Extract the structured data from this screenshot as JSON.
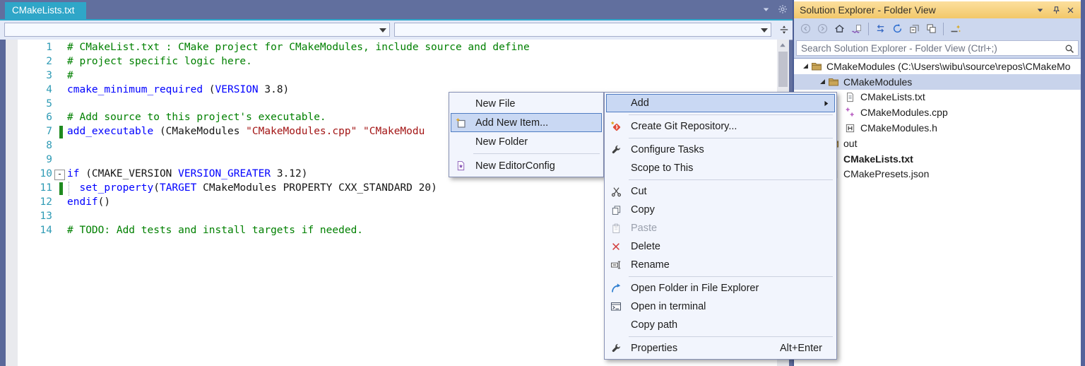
{
  "colors": {
    "tab_active": "#2fa6c8",
    "env_background": "#616f9e",
    "menu_highlight": "#c9d8f3",
    "menu_highlight_border": "#4f7cc2",
    "panel_title_orange": "#f5cc84",
    "tree_selection": "#c8d3eb",
    "comment": "#008000",
    "keyword": "#0000ff",
    "string": "#a31515",
    "line_number": "#2f9bb5",
    "change_bar_green": "#1f8a1f"
  },
  "editor": {
    "tab_label": "CMakeLists.txt",
    "lines": [
      {
        "n": 1,
        "tokens": [
          [
            "c",
            "# CMakeList.txt : CMake project for CMakeModules, include source and define"
          ]
        ]
      },
      {
        "n": 2,
        "tokens": [
          [
            "c",
            "# project specific logic here."
          ]
        ]
      },
      {
        "n": 3,
        "tokens": [
          [
            "c",
            "#"
          ]
        ]
      },
      {
        "n": 4,
        "tokens": [
          [
            "k",
            "cmake_minimum_required"
          ],
          [
            "p",
            " ("
          ],
          [
            "k",
            "VERSION"
          ],
          [
            "p",
            " 3.8)"
          ]
        ]
      },
      {
        "n": 5,
        "tokens": []
      },
      {
        "n": 6,
        "tokens": [
          [
            "c",
            "# Add source to this project's executable."
          ]
        ]
      },
      {
        "n": 7,
        "changed": true,
        "tokens": [
          [
            "k",
            "add_executable"
          ],
          [
            "p",
            " (CMakeModules "
          ],
          [
            "s",
            "\"CMakeModules.cpp\""
          ],
          [
            "p",
            " "
          ],
          [
            "s",
            "\"CMakeModu"
          ]
        ]
      },
      {
        "n": 8,
        "tokens": []
      },
      {
        "n": 9,
        "tokens": []
      },
      {
        "n": 10,
        "fold": true,
        "tokens": [
          [
            "k",
            "if"
          ],
          [
            "p",
            " (CMAKE_VERSION "
          ],
          [
            "k",
            "VERSION_GREATER"
          ],
          [
            "p",
            " 3.12)"
          ]
        ]
      },
      {
        "n": 11,
        "changed": true,
        "guide": true,
        "tokens": [
          [
            "p",
            "  "
          ],
          [
            "k",
            "set_property"
          ],
          [
            "p",
            "("
          ],
          [
            "k",
            "TARGET"
          ],
          [
            "p",
            " CMakeModules PROPERTY CXX_STANDARD 20)"
          ]
        ]
      },
      {
        "n": 12,
        "tokens": [
          [
            "k",
            "endif"
          ],
          [
            "p",
            "()"
          ]
        ]
      },
      {
        "n": 13,
        "tokens": []
      },
      {
        "n": 14,
        "tokens": [
          [
            "c",
            "# TODO: Add tests and install targets if needed."
          ]
        ]
      }
    ]
  },
  "add_submenu": {
    "items": [
      {
        "label": "New File"
      },
      {
        "label": "Add New Item...",
        "icon": "add-new-item",
        "highlighted": true
      },
      {
        "label": "New Folder"
      },
      {
        "sep": true
      },
      {
        "label": "New EditorConfig",
        "icon": "editorconfig"
      }
    ]
  },
  "context_menu": {
    "items": [
      {
        "label": "Add",
        "arrow": true,
        "highlighted": true
      },
      {
        "sep": true
      },
      {
        "label": "Create Git Repository...",
        "icon": "git"
      },
      {
        "sep": true
      },
      {
        "label": "Configure Tasks",
        "icon": "wrench"
      },
      {
        "label": "Scope to This"
      },
      {
        "sep": true
      },
      {
        "label": "Cut",
        "icon": "cut"
      },
      {
        "label": "Copy",
        "icon": "copy"
      },
      {
        "label": "Paste",
        "icon": "paste",
        "disabled": true
      },
      {
        "label": "Delete",
        "icon": "delete"
      },
      {
        "label": "Rename",
        "icon": "rename"
      },
      {
        "sep": true
      },
      {
        "label": "Open Folder in File Explorer",
        "icon": "open-folder"
      },
      {
        "label": "Open in terminal",
        "icon": "terminal"
      },
      {
        "label": "Copy path"
      },
      {
        "sep": true
      },
      {
        "label": "Properties",
        "icon": "wrench",
        "shortcut": "Alt+Enter"
      }
    ]
  },
  "solution_explorer": {
    "title": "Solution Explorer - Folder View",
    "search_placeholder": "Search Solution Explorer - Folder View (Ctrl+;)",
    "toolbar": [
      {
        "icon": "nav-back",
        "disabled": true
      },
      {
        "icon": "nav-forward",
        "disabled": true
      },
      {
        "icon": "home"
      },
      {
        "icon": "switch-views"
      },
      {
        "sep": true
      },
      {
        "icon": "sync"
      },
      {
        "icon": "refresh"
      },
      {
        "icon": "collapse-all"
      },
      {
        "icon": "show-all-files"
      },
      {
        "sep": true
      },
      {
        "icon": "new-view"
      }
    ],
    "tree": [
      {
        "label": "CMakeModules (C:\\Users\\wibu\\source\\repos\\CMakeMo",
        "icon": "folder",
        "level": 0,
        "expanded": true
      },
      {
        "label": "CMakeModules",
        "icon": "folder",
        "level": 1,
        "expanded": true,
        "selected": true
      },
      {
        "label": "CMakeLists.txt",
        "icon": "doc",
        "level": 2
      },
      {
        "label": "CMakeModules.cpp",
        "icon": "cpp",
        "level": 2
      },
      {
        "label": "CMakeModules.h",
        "icon": "hfile",
        "level": 2
      },
      {
        "label": "out",
        "icon": "folder",
        "level": 1
      },
      {
        "label": "CMakeLists.txt",
        "icon": "doc",
        "level": 1,
        "bold": true
      },
      {
        "label": "CMakePresets.json",
        "icon": "json",
        "level": 1
      }
    ]
  }
}
